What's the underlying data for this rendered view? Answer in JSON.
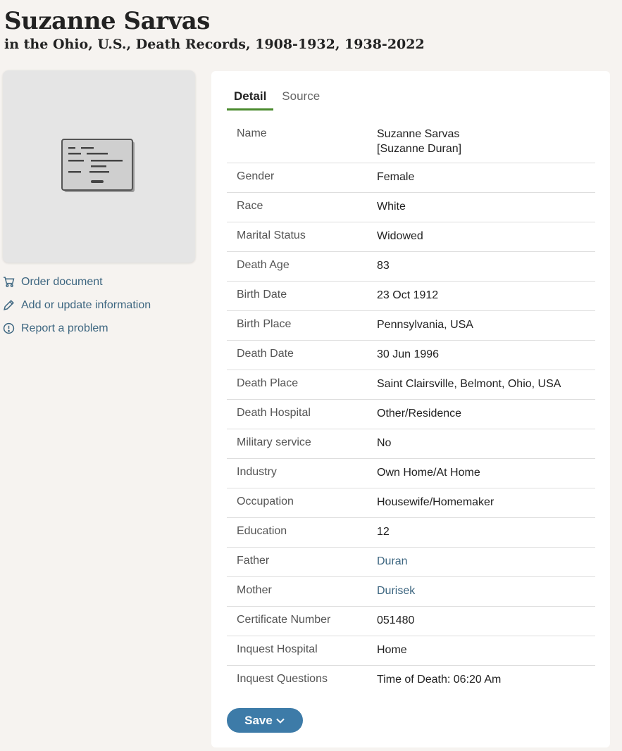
{
  "header": {
    "title": "Suzanne Sarvas",
    "subtitle": "in the Ohio, U.S., Death Records, 1908-1932, 1938-2022"
  },
  "thumbnail": {
    "icon": "document-record-icon"
  },
  "actions": [
    {
      "label": "Order document",
      "icon": "cart-icon"
    },
    {
      "label": "Add or update information",
      "icon": "pencil-icon"
    },
    {
      "label": "Report a problem",
      "icon": "alert-circle-icon"
    }
  ],
  "tabs": [
    {
      "label": "Detail",
      "active": true
    },
    {
      "label": "Source",
      "active": false
    }
  ],
  "record": {
    "name_line1": "Suzanne Sarvas",
    "name_line2": "[Suzanne Duran]",
    "fields": [
      {
        "label": "Name"
      },
      {
        "label": "Gender",
        "value": "Female"
      },
      {
        "label": "Race",
        "value": "White"
      },
      {
        "label": "Marital Status",
        "value": "Widowed"
      },
      {
        "label": "Death Age",
        "value": "83"
      },
      {
        "label": "Birth Date",
        "value": "23 Oct 1912"
      },
      {
        "label": "Birth Place",
        "value": "Pennsylvania, USA"
      },
      {
        "label": "Death Date",
        "value": "30 Jun 1996"
      },
      {
        "label": "Death Place",
        "value": "Saint Clairsville, Belmont, Ohio, USA"
      },
      {
        "label": "Death Hospital",
        "value": "Other/Residence"
      },
      {
        "label": "Military service",
        "value": "No"
      },
      {
        "label": "Industry",
        "value": "Own Home/At Home"
      },
      {
        "label": "Occupation",
        "value": "Housewife/Homemaker"
      },
      {
        "label": "Education",
        "value": "12"
      },
      {
        "label": "Father",
        "value": "Duran"
      },
      {
        "label": "Mother",
        "value": "Durisek"
      },
      {
        "label": "Certificate Number",
        "value": "051480"
      },
      {
        "label": "Inquest Hospital",
        "value": "Home"
      },
      {
        "label": "Inquest Questions",
        "value": "Time of Death: 06:20 Am"
      }
    ]
  },
  "save_button": {
    "label": "Save",
    "icon": "chevron-down-icon"
  },
  "colors": {
    "link": "#3d6680",
    "accent_tab": "#4a8a2e",
    "save_bg": "#3d7ba8",
    "page_bg": "#f6f3f0"
  }
}
